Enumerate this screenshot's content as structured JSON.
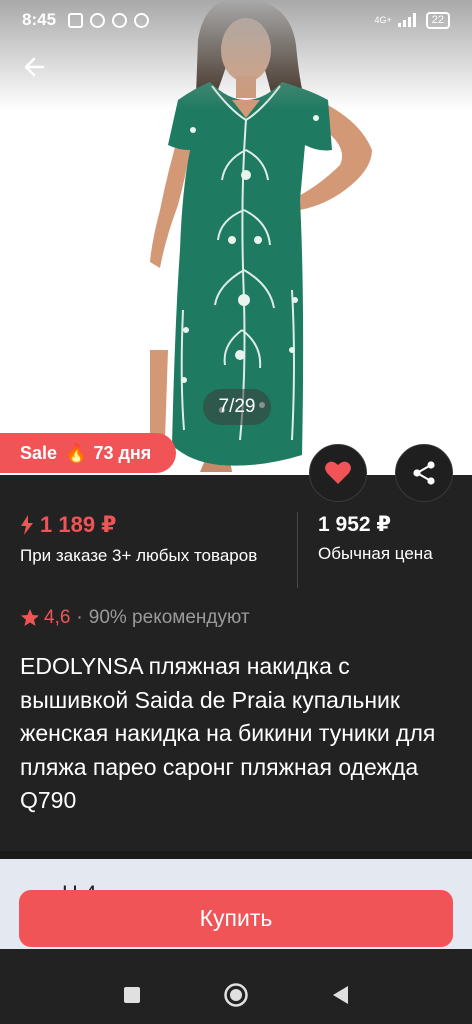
{
  "status_bar": {
    "time": "8:45",
    "network": "4G+",
    "battery": "22"
  },
  "gallery": {
    "counter": "7/29",
    "icons": [
      "back-arrow-icon"
    ]
  },
  "sale_badge": {
    "label": "Sale",
    "emoji": "🔥",
    "days": "73 дня"
  },
  "actions": {
    "favorite_icon": "heart-icon",
    "share_icon": "share-icon",
    "accent_color": "#f05457"
  },
  "price": {
    "sale_price": "1 189 ₽",
    "sale_note": "При заказе 3+ любых товаров",
    "regular_price": "1 952 ₽",
    "regular_note": "Обычная цена"
  },
  "rating": {
    "value": "4,6",
    "separator": "·",
    "recommend": "90% рекомендуют"
  },
  "product": {
    "title": "EDOLYNSA пляжная накидка с вышивкой Saida de Praia купальник женская накидка на бикини туники для пляжа парео саронг пляжная одежда Q790"
  },
  "buy_button": {
    "label": "Купить"
  },
  "next_panel": {
    "peek_text": "Ц                      4"
  },
  "nav": {
    "icons": [
      "recents-square-icon",
      "home-circle-icon",
      "back-triangle-icon"
    ]
  }
}
